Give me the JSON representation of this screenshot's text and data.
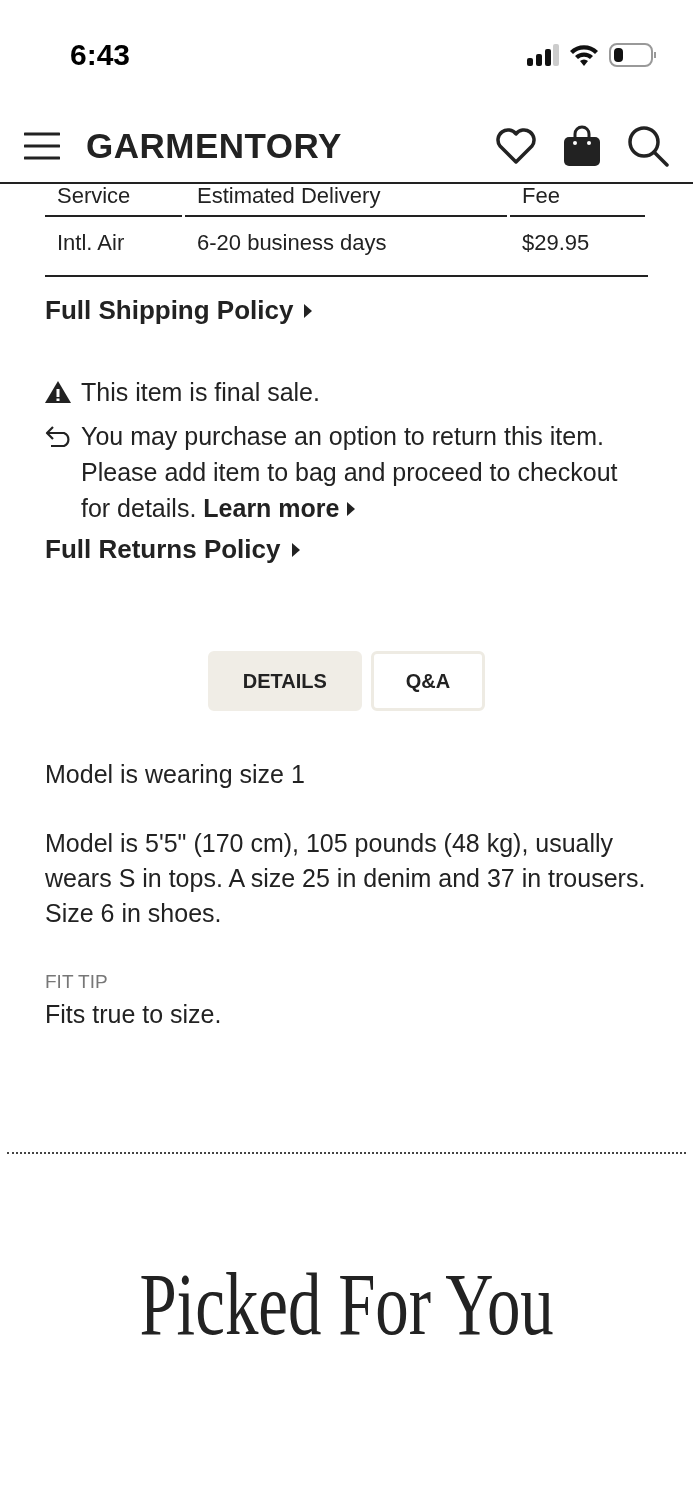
{
  "status_bar": {
    "time": "6:43"
  },
  "header": {
    "logo": "GARMENTORY"
  },
  "shipping_table": {
    "columns": [
      "Service",
      "Estimated Delivery",
      "Fee"
    ],
    "rows": [
      [
        "Intl. Air",
        "6-20 business days",
        "$29.95"
      ]
    ]
  },
  "shipping_link": "Full Shipping Policy",
  "final_sale": "This item is final sale.",
  "return_note": {
    "text": "You may purchase an option to return this item. Please add item to bag and proceed to checkout for details.",
    "link": "Learn more"
  },
  "returns_link": "Full Returns Policy",
  "tabs": [
    {
      "label": "DETAILS",
      "selected": true
    },
    {
      "label": "Q&A",
      "selected": false
    }
  ],
  "details": {
    "paragraphs": [
      "Model is wearing size 1",
      "Model is 5'5\" (170 cm), 105 pounds (48 kg), usually wears S in tops. A size 25 in denim and 37 in trousers. Size 6 in shoes."
    ],
    "fit_tip": {
      "label": "FIT TIP",
      "text": "Fits true to size."
    }
  },
  "section_title": "Picked For You"
}
